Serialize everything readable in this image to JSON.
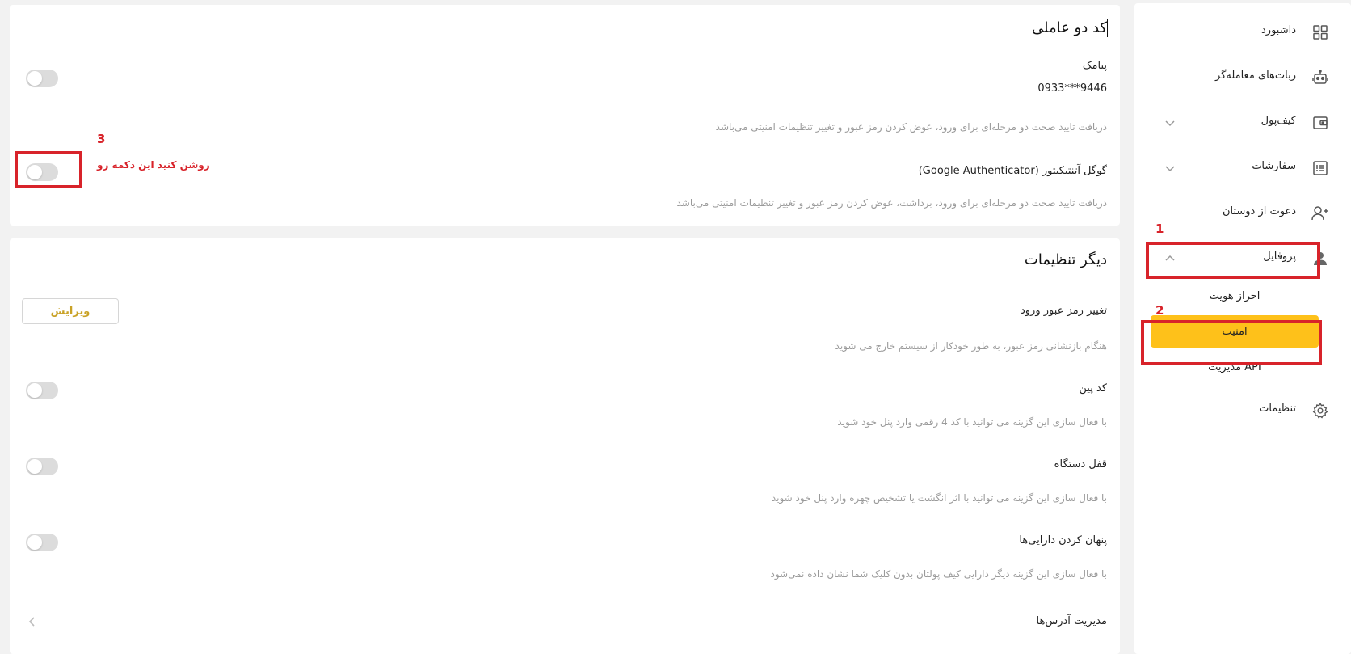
{
  "sidebar": {
    "items": [
      {
        "label": "داشبورد",
        "icon": "grid-icon"
      },
      {
        "label": "ربات‌های معامله‌گر",
        "icon": "robot-icon"
      },
      {
        "label": "کیف‌پول",
        "icon": "wallet-icon"
      },
      {
        "label": "سفارشات",
        "icon": "list-icon"
      },
      {
        "label": "دعوت از دوستان",
        "icon": "user-plus-icon"
      },
      {
        "label": "پروفایل",
        "icon": "user-icon"
      },
      {
        "label": "تنظیمات",
        "icon": "gear-icon"
      }
    ],
    "profile_sub": [
      {
        "label": "احراز هویت"
      },
      {
        "label": "امنیت",
        "active": true
      },
      {
        "label": "مدیریت API"
      }
    ]
  },
  "annotations": {
    "num1": "1",
    "num2": "2",
    "num3": "3",
    "note3": "روشن کنید این دکمه رو",
    "color": "#d8232a"
  },
  "two_factor": {
    "title": "کد دو عاملی",
    "sms_title": "پیامک",
    "sms_phone": "0933***9446",
    "sms_desc": "دریافت تایید صحت دو مرحله‌ای برای ورود، عوض کردن رمز عبور و تغییر تنظیمات امنیتی می‌باشد",
    "ga_title": "گوگل آتنتیکیتور (Google Authenticator)",
    "ga_desc": "دریافت تایید صحت دو مرحله‌ای برای ورود، برداشت، عوض کردن رمز عبور و تغییر تنظیمات امنیتی می‌باشد"
  },
  "other_settings": {
    "title": "دیگر تنظیمات",
    "password_title": "تغییر رمز عبور ورود",
    "password_desc": "هنگام بازنشانی رمز عبور، به طور خودکار از سیستم خارج می شوید",
    "edit_label": "ویرایش",
    "pin_title": "کد پین",
    "pin_desc": "با فعال سازی این گزینه می توانید با کد 4 رقمی وارد پنل خود شوید",
    "lock_title": "قفل دستگاه",
    "lock_desc": "با فعال سازی این گزینه می توانید با اثر انگشت یا تشخیص چهره وارد پنل خود شوید",
    "hide_title": "پنهان کردن دارایی‌ها",
    "hide_desc": "با فعال سازی این گزینه دیگر دارایی کیف پولتان بدون کلیک شما نشان داده نمی‌شود",
    "address_title": "مدیریت آدرس‌ها"
  },
  "colors": {
    "accent": "#fec11a",
    "edit_text": "#c9a227",
    "annotation": "#d8232a"
  }
}
